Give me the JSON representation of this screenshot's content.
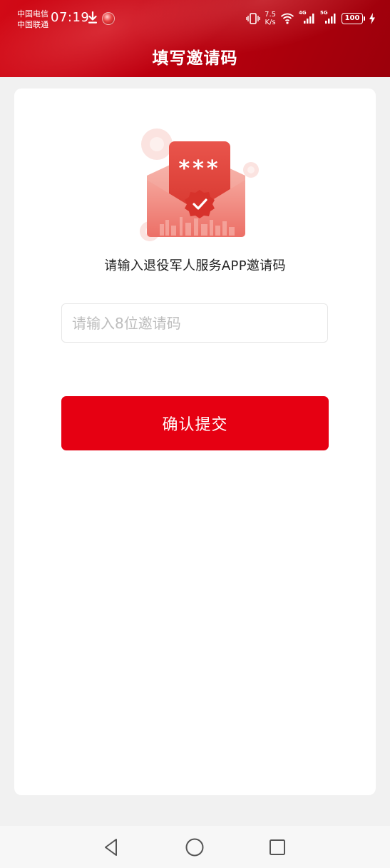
{
  "status_bar": {
    "carrier_1": "中国电信",
    "carrier_2": "中国联通",
    "time": "07:19",
    "net_speed_value": "7.5",
    "net_speed_unit": "K/s",
    "signal_1_tag": "4G",
    "signal_2_tag": "5G",
    "battery": "100",
    "icons": [
      "download-icon",
      "recording-icon",
      "vibrate-icon",
      "wifi-icon",
      "signal-icon",
      "battery-icon",
      "charging-icon"
    ]
  },
  "header": {
    "title": "填写邀请码"
  },
  "main": {
    "illustration_text": "***",
    "prompt": "请输入退役军人服务APP邀请码",
    "code_input": {
      "value": "",
      "placeholder": "请输入8位邀请码"
    },
    "submit_label": "确认提交"
  },
  "navbar": {
    "buttons": [
      "back-icon",
      "home-icon",
      "recents-icon"
    ]
  },
  "colors": {
    "primary": "#e60012",
    "header": "#c10010",
    "background": "#f1f1f1",
    "card": "#ffffff"
  }
}
